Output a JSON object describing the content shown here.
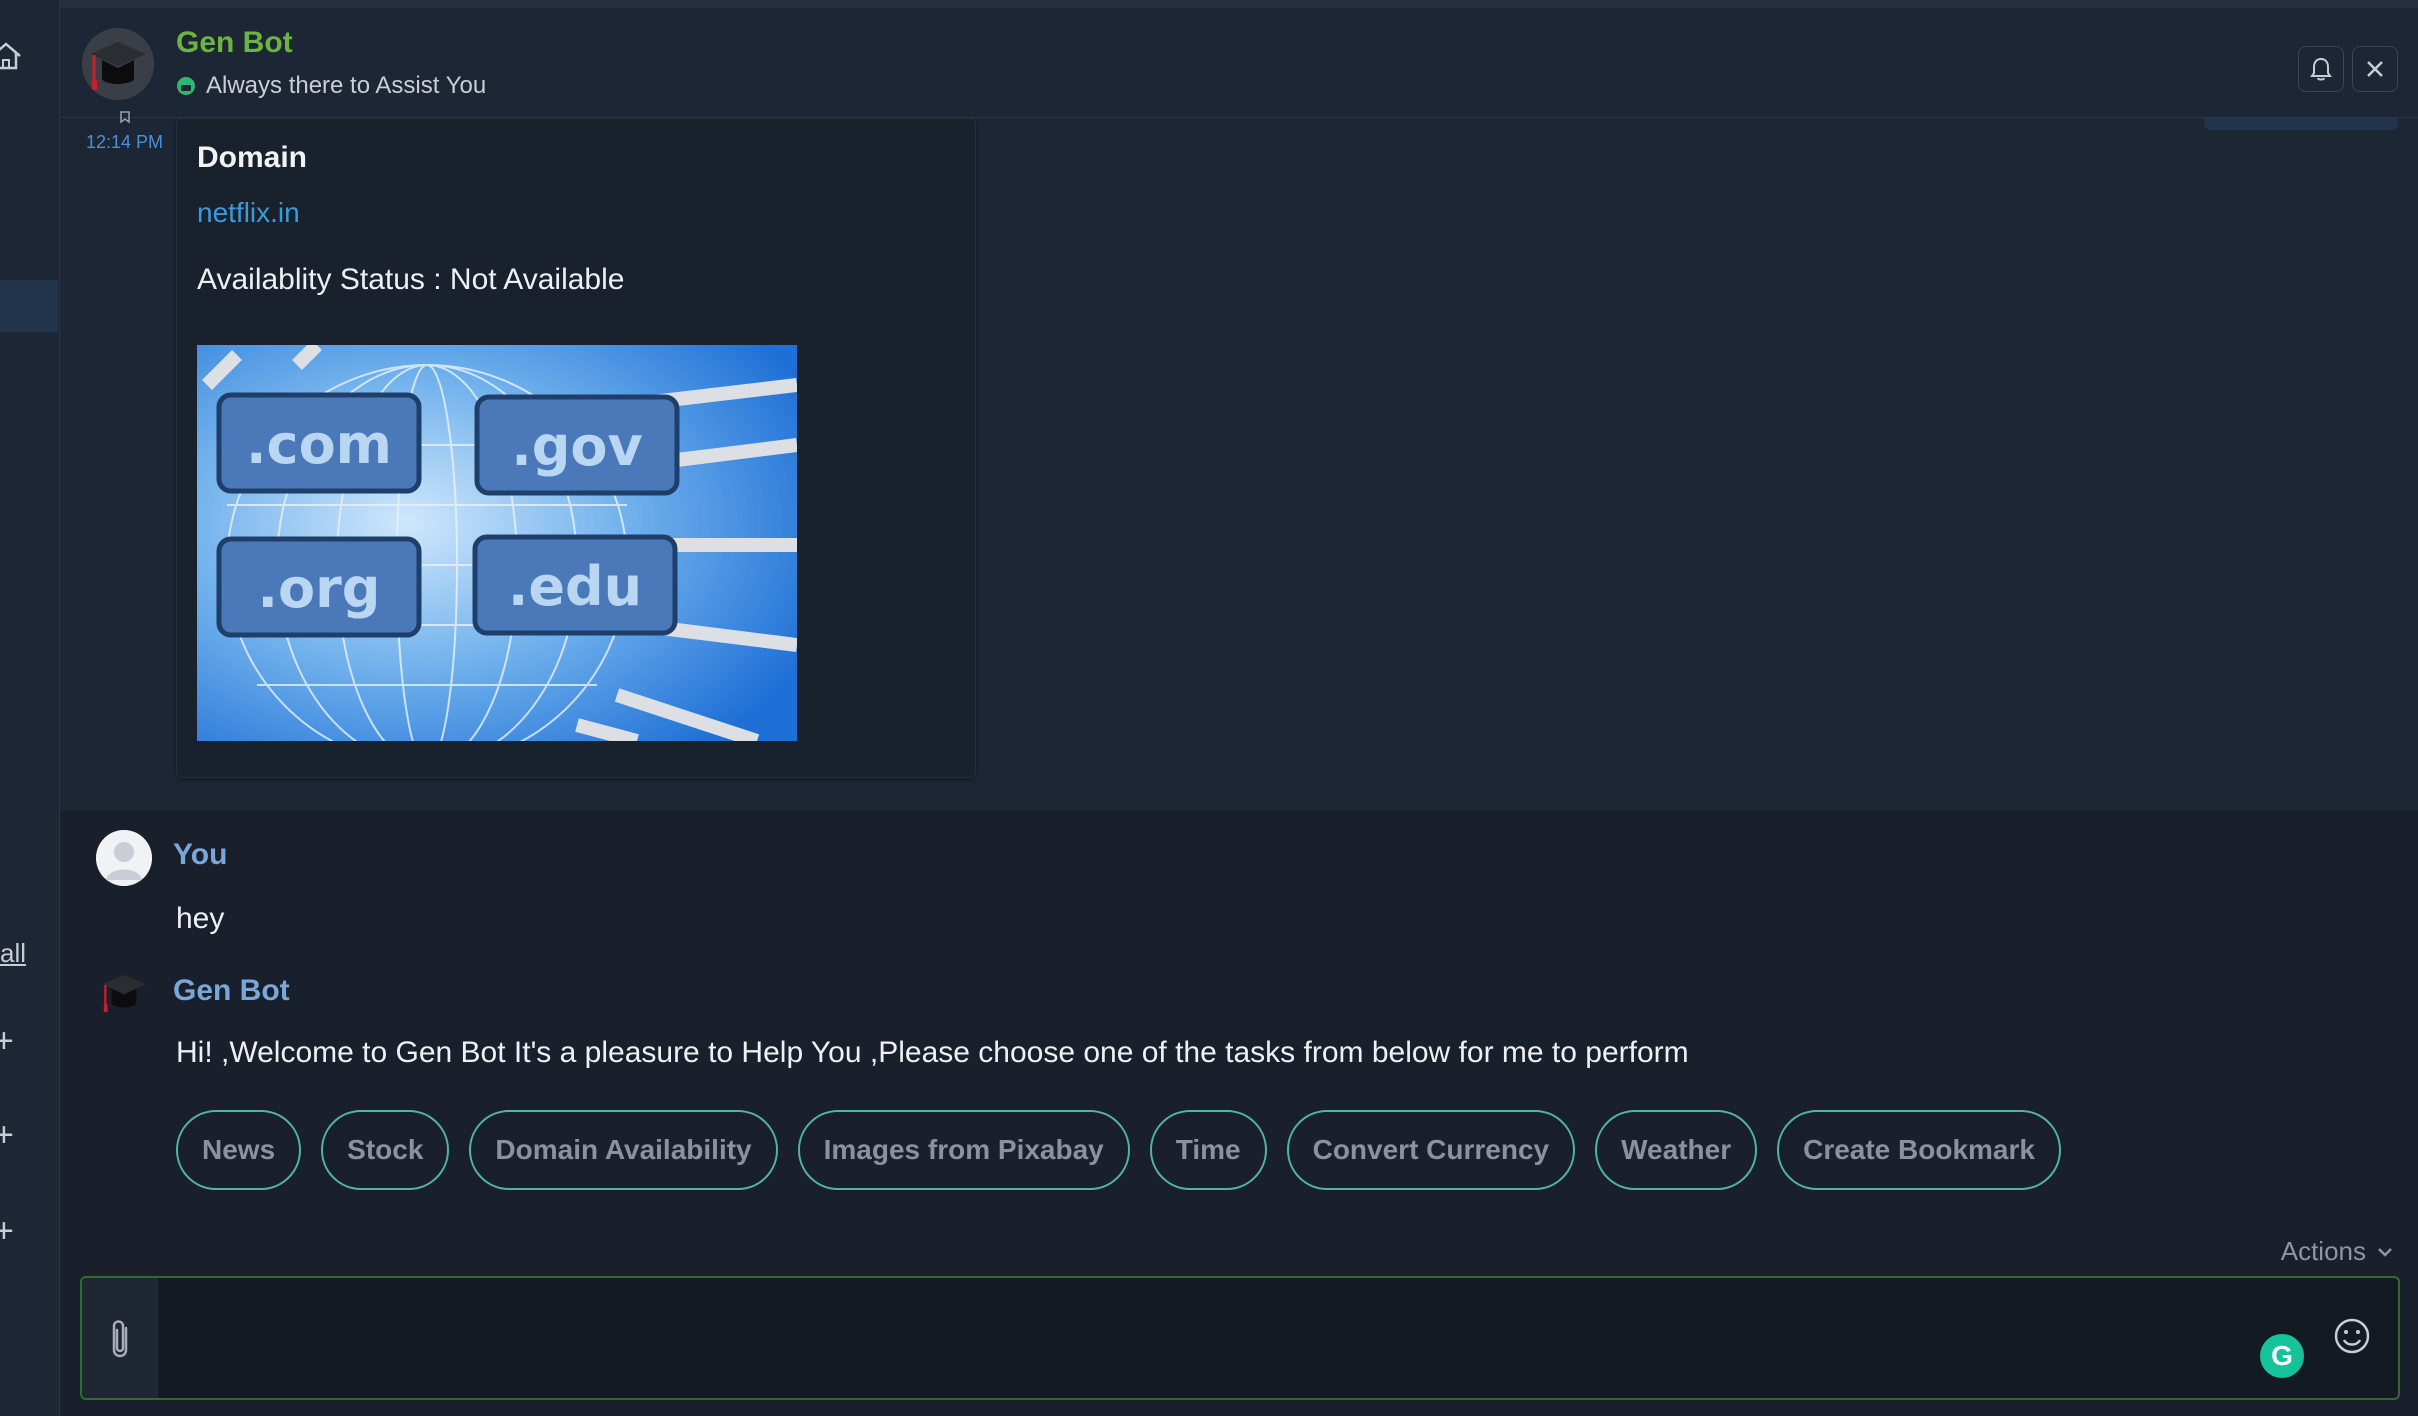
{
  "header": {
    "title": "Gen Bot",
    "subtitle": "Always there to Assist You"
  },
  "sidebar": {
    "all_label": "all",
    "plus_label": "+"
  },
  "card": {
    "time": "12:14 PM",
    "domain_label": "Domain",
    "domain_link": "netflix.in",
    "status": "Availablity Status : Not Available",
    "image_tags": [
      ".com",
      ".gov",
      ".org",
      ".edu"
    ]
  },
  "messages": {
    "you_name": "You",
    "you_text": "hey",
    "bot_name": "Gen Bot",
    "bot_text": "Hi! ,Welcome to Gen Bot It's a pleasure to Help You ,Please choose one of the tasks from below for me to perform"
  },
  "quick_replies": [
    "News",
    "Stock",
    "Domain Availability",
    "Images from Pixabay",
    "Time",
    "Convert Currency",
    "Weather",
    "Create Bookmark"
  ],
  "actions_label": "Actions",
  "composer": {
    "value": "",
    "grammarly_letter": "G"
  },
  "colors": {
    "accent_green": "#6db33f",
    "link_blue": "#3d9ad9",
    "quick_reply_border": "#52b4a5"
  }
}
